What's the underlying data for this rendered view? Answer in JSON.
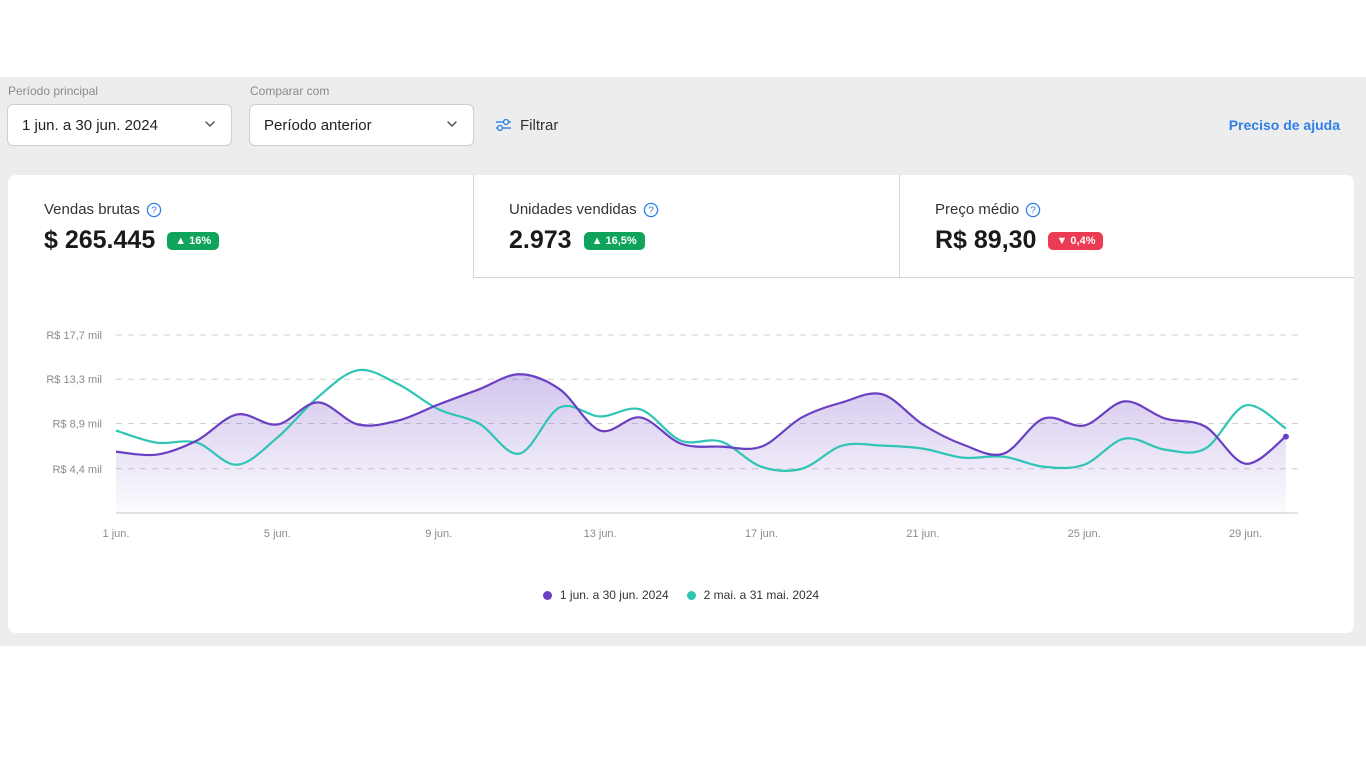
{
  "filters": {
    "main_period_label": "Período principal",
    "main_period_value": "1 jun. a 30 jun. 2024",
    "compare_label": "Comparar com",
    "compare_value": "Período anterior",
    "filter_label": "Filtrar",
    "help_link": "Preciso de ajuda"
  },
  "kpis": [
    {
      "title": "Vendas brutas",
      "value": "$ 265.445",
      "badge": "▲ 16%",
      "trend": "up"
    },
    {
      "title": "Unidades vendidas",
      "value": "2.973",
      "badge": "▲ 16,5%",
      "trend": "up"
    },
    {
      "title": "Preço médio",
      "value": "R$ 89,30",
      "badge": "▼ 0,4%",
      "trend": "down"
    }
  ],
  "colors": {
    "primary": "#6a3fc3",
    "secondary": "#2ec4b6",
    "up": "#0fa35b",
    "down": "#ea3b52",
    "link": "#2f7fe6"
  },
  "chart_data": {
    "type": "line",
    "x_tick_labels": [
      "1 jun.",
      "5 jun.",
      "9 jun.",
      "13 jun.",
      "17 jun.",
      "21 jun.",
      "25 jun.",
      "29 jun."
    ],
    "x_tick_days": [
      1,
      5,
      9,
      13,
      17,
      21,
      25,
      29
    ],
    "y_tick_labels": [
      "R$ 4,4 mil",
      "R$ 8,9 mil",
      "R$ 13,3 mil",
      "R$ 17,7 mil"
    ],
    "y_tick_values": [
      4.4,
      8.9,
      13.3,
      17.7
    ],
    "ylim": [
      0,
      17.7
    ],
    "grid": "horizontal dashed",
    "series": [
      {
        "name": "1 jun. a 30 jun. 2024",
        "x": [
          1,
          2,
          3,
          4,
          5,
          6,
          7,
          8,
          9,
          10,
          11,
          12,
          13,
          14,
          15,
          16,
          17,
          18,
          19,
          20,
          21,
          22,
          23,
          24,
          25,
          26,
          27,
          28,
          29,
          30
        ],
        "values": [
          6.1,
          5.8,
          7.2,
          9.8,
          8.8,
          11.0,
          8.8,
          9.2,
          10.8,
          12.3,
          13.8,
          12.3,
          8.2,
          9.5,
          6.9,
          6.6,
          6.6,
          9.5,
          11.0,
          11.8,
          8.8,
          6.8,
          5.9,
          9.4,
          8.7,
          11.1,
          9.4,
          8.6,
          4.9,
          7.6
        ],
        "filled": true
      },
      {
        "name": "2 mai. a 31 mai. 2024",
        "x": [
          1,
          2,
          3,
          4,
          5,
          6,
          7,
          8,
          9,
          10,
          11,
          12,
          13,
          14,
          15,
          16,
          17,
          18,
          19,
          20,
          21,
          22,
          23,
          24,
          25,
          26,
          27,
          28,
          29,
          30
        ],
        "values": [
          8.2,
          7.0,
          7.0,
          4.8,
          7.5,
          11.5,
          14.2,
          12.8,
          10.3,
          8.9,
          5.9,
          10.5,
          9.6,
          10.3,
          7.2,
          7.1,
          4.6,
          4.4,
          6.7,
          6.7,
          6.4,
          5.5,
          5.6,
          4.6,
          4.8,
          7.4,
          6.3,
          6.4,
          10.7,
          8.4
        ],
        "filled": false
      }
    ]
  }
}
